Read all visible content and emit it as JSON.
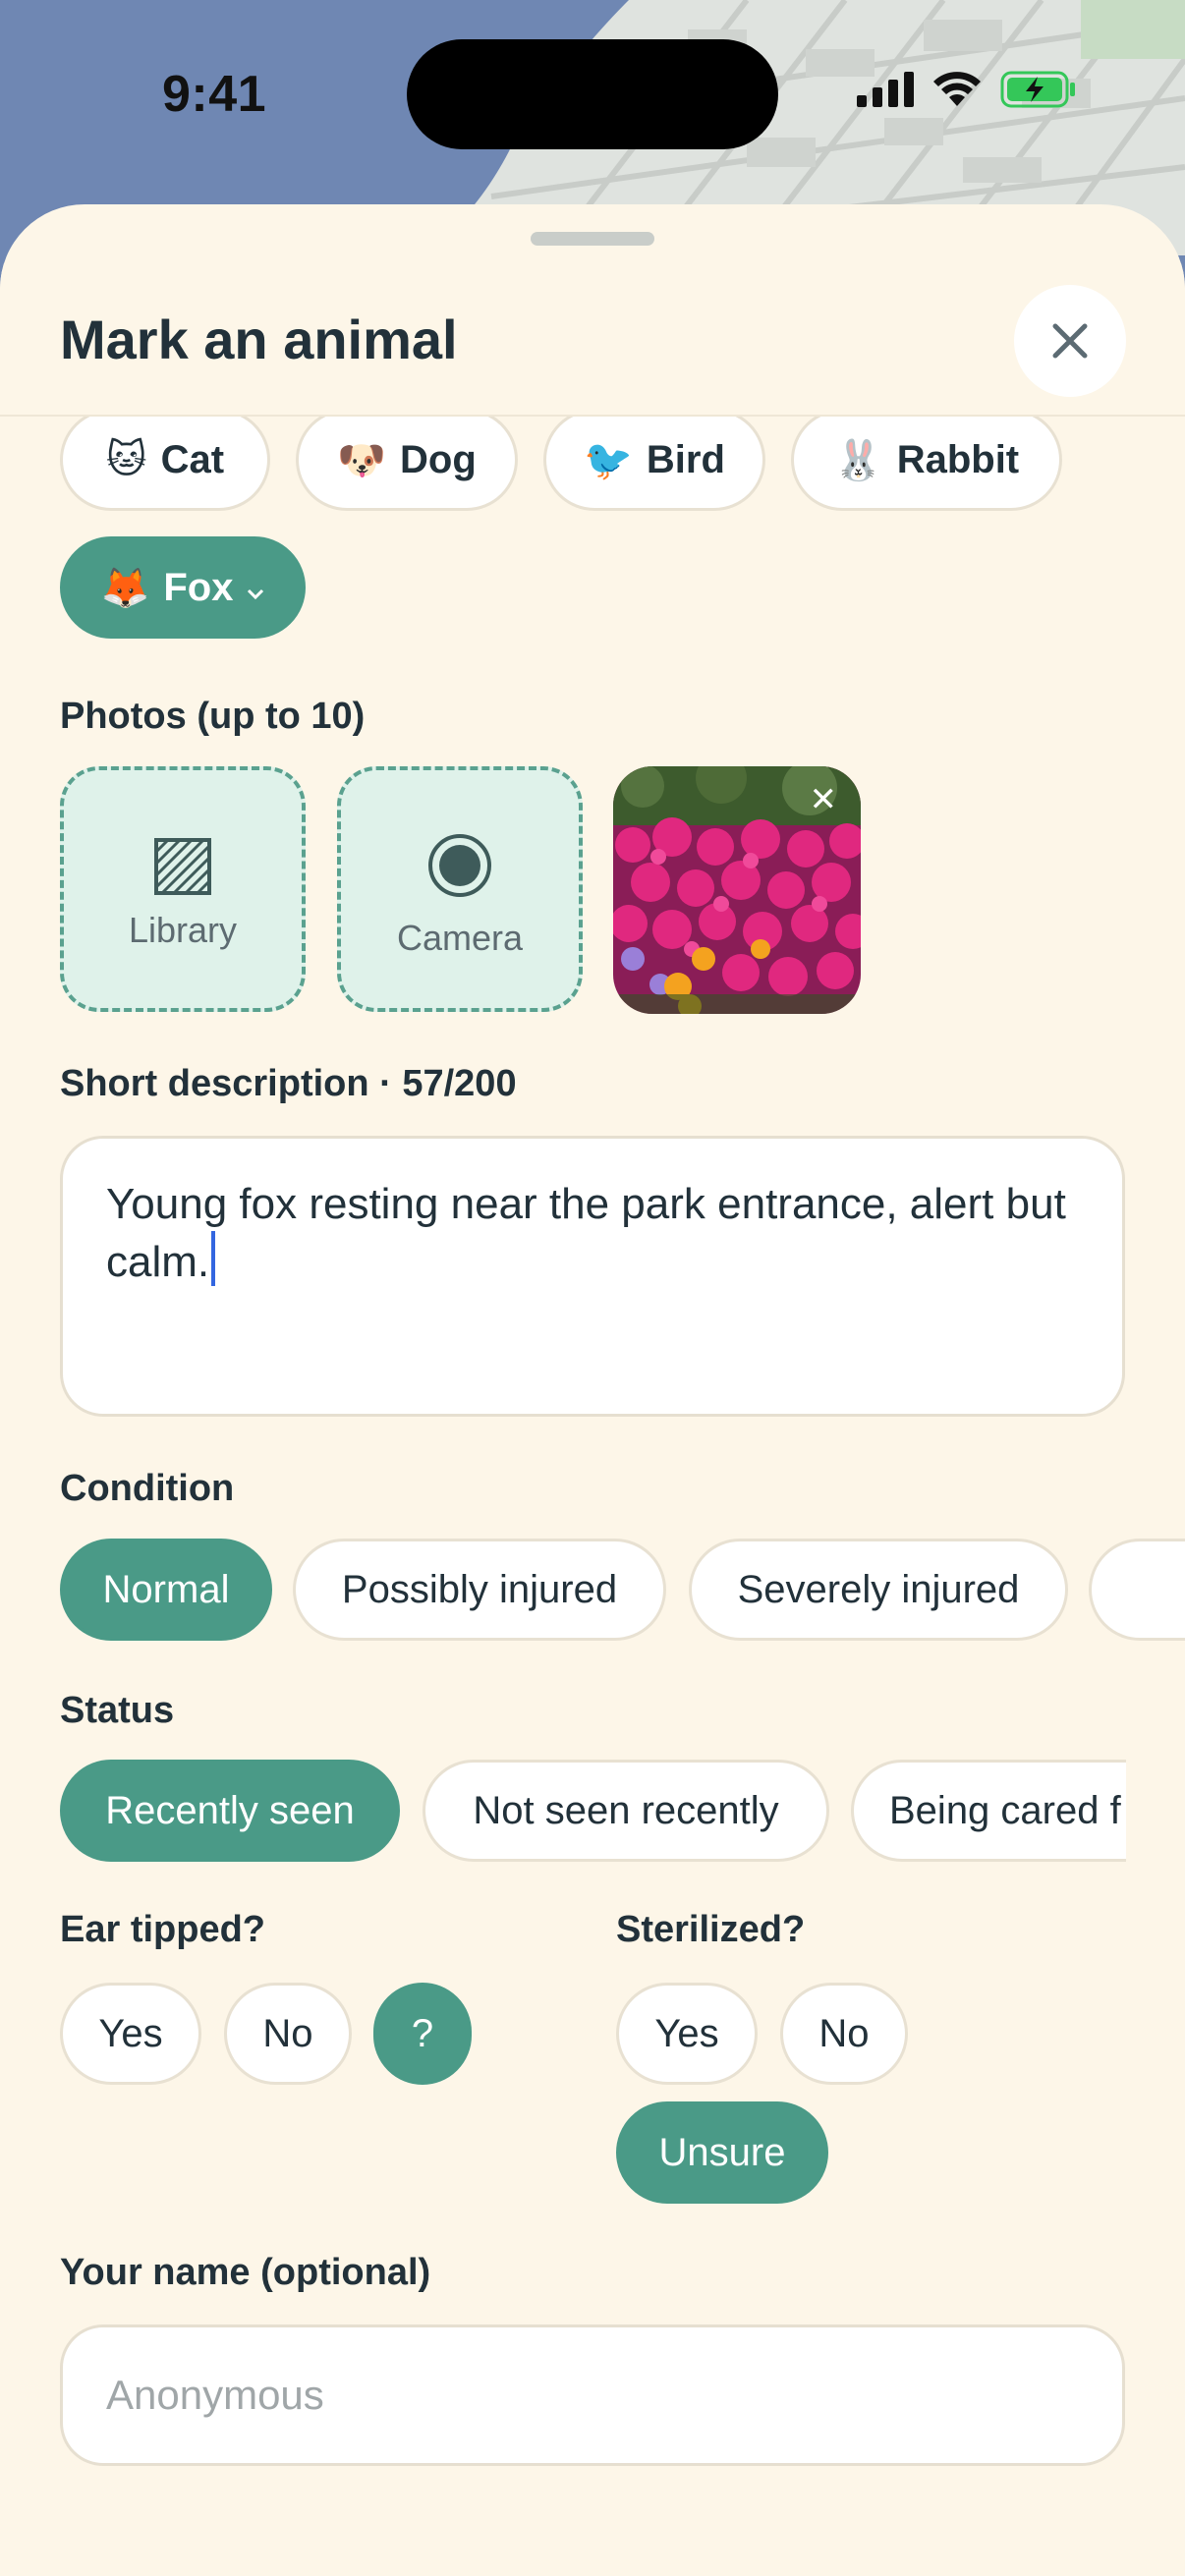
{
  "status_bar": {
    "time": "9:41"
  },
  "sheet": {
    "title": "Mark an animal"
  },
  "animal_types": [
    {
      "emoji": "🐱",
      "label": "Cat"
    },
    {
      "emoji": "🐶",
      "label": "Dog"
    },
    {
      "emoji": "🐦",
      "label": "Bird"
    },
    {
      "emoji": "🐰",
      "label": "Rabbit"
    },
    {
      "emoji": "🦊",
      "label": "Fox",
      "selected": true
    }
  ],
  "photos": {
    "label": "Photos (up to 10)",
    "library_label": "Library",
    "camera_label": "Camera"
  },
  "description": {
    "label": "Short description · 57/200",
    "value": "Young fox resting near the park entrance, alert but calm."
  },
  "condition": {
    "label": "Condition",
    "options": [
      "Normal",
      "Possibly injured",
      "Severely injured"
    ],
    "selected": "Normal"
  },
  "status": {
    "label": "Status",
    "options": [
      "Recently seen",
      "Not seen recently",
      "Being cared f"
    ],
    "selected": "Recently seen"
  },
  "ear_tipped": {
    "label": "Ear tipped?",
    "options": [
      "Yes",
      "No",
      "?"
    ],
    "selected": "?"
  },
  "sterilized": {
    "label": "Sterilized?",
    "options": [
      "Yes",
      "No",
      "Unsure"
    ],
    "selected": "Unsure"
  },
  "name": {
    "label": "Your name (optional)",
    "placeholder": "Anonymous"
  },
  "colors": {
    "accent": "#4a9a87",
    "sheet_bg": "#fdf6e8",
    "tile_bg": "#dff2ea"
  }
}
